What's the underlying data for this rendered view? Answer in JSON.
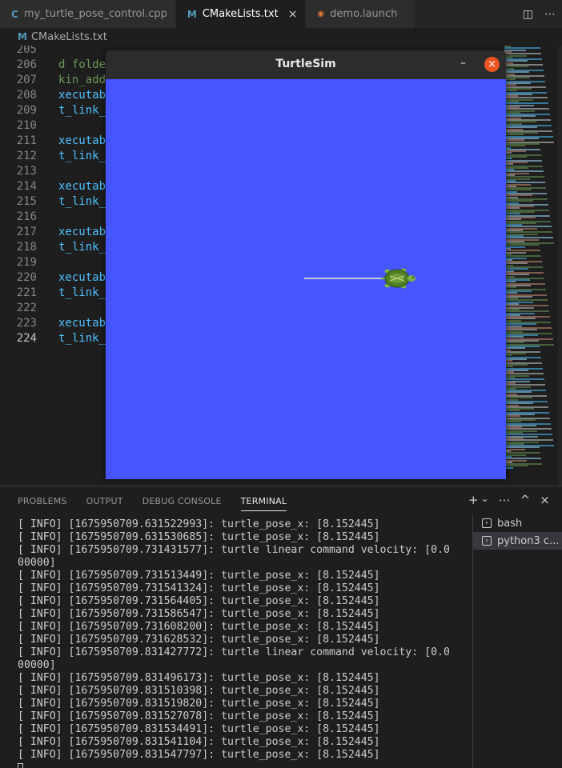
{
  "tabs": [
    {
      "icon": "C",
      "label": "my_turtle_pose_control.cpp",
      "color": "#519aba"
    },
    {
      "icon": "M",
      "label": "CMakeLists.txt",
      "color": "#519aba",
      "close": "×"
    },
    {
      "icon": "RSS",
      "label": "demo.launch",
      "color": "#e37933"
    }
  ],
  "breadcrumb": {
    "icon": "M",
    "label": "CMakeLists.txt"
  },
  "editor": {
    "lines": [
      {
        "num": "205",
        "text": "",
        "cls": ""
      },
      {
        "num": "206",
        "text": "d folde",
        "cls": "c-green"
      },
      {
        "num": "207",
        "text": "kin_add",
        "cls": "c-green"
      },
      {
        "num": "208",
        "text": "xecutab",
        "cls": "c-blue"
      },
      {
        "num": "209",
        "text": "t_link_",
        "cls": "c-blue"
      },
      {
        "num": "210",
        "text": "",
        "cls": ""
      },
      {
        "num": "211",
        "text": "xecutab",
        "cls": "c-blue"
      },
      {
        "num": "212",
        "text": "t_link_",
        "cls": "c-blue"
      },
      {
        "num": "213",
        "text": "",
        "cls": ""
      },
      {
        "num": "214",
        "text": "xecutab",
        "cls": "c-blue"
      },
      {
        "num": "215",
        "text": "t_link_",
        "cls": "c-blue"
      },
      {
        "num": "216",
        "text": "",
        "cls": ""
      },
      {
        "num": "217",
        "text": "xecutab",
        "cls": "c-blue"
      },
      {
        "num": "218",
        "text": "t_link_",
        "cls": "c-blue"
      },
      {
        "num": "219",
        "text": "",
        "cls": ""
      },
      {
        "num": "220",
        "text": "xecutab",
        "cls": "c-blue"
      },
      {
        "num": "221",
        "text": "t_link_",
        "cls": "c-blue"
      },
      {
        "num": "222",
        "text": "",
        "cls": ""
      },
      {
        "num": "223",
        "text": "xecutab",
        "cls": "c-blue"
      },
      {
        "num": "224",
        "text": "t_link_",
        "cls": "c-blue"
      }
    ]
  },
  "turtlesim": {
    "title": "TurtleSim",
    "background": "#4556ff",
    "minimize": "–",
    "close": "×"
  },
  "panel": {
    "tabs": [
      "PROBLEMS",
      "OUTPUT",
      "DEBUG CONSOLE",
      "TERMINAL"
    ],
    "active_tab": "TERMINAL",
    "actions": [
      "+",
      "⌄",
      "⋯",
      "^",
      "×"
    ],
    "terminal_lines": [
      "[ INFO] [1675950709.631522993]: turtle_pose_x: [8.152445]",
      "[ INFO] [1675950709.631530685]: turtle_pose_x: [8.152445]",
      "[ INFO] [1675950709.731431577]: turtle linear command velocity: [0.0",
      "00000]",
      "[ INFO] [1675950709.731513449]: turtle_pose_x: [8.152445]",
      "[ INFO] [1675950709.731541324]: turtle_pose_x: [8.152445]",
      "[ INFO] [1675950709.731564405]: turtle_pose_x: [8.152445]",
      "[ INFO] [1675950709.731586547]: turtle_pose_x: [8.152445]",
      "[ INFO] [1675950709.731608200]: turtle_pose_x: [8.152445]",
      "[ INFO] [1675950709.731628532]: turtle_pose_x: [8.152445]",
      "[ INFO] [1675950709.831427772]: turtle linear command velocity: [0.0",
      "00000]",
      "[ INFO] [1675950709.831496173]: turtle_pose_x: [8.152445]",
      "[ INFO] [1675950709.831510398]: turtle_pose_x: [8.152445]",
      "[ INFO] [1675950709.831519820]: turtle_pose_x: [8.152445]",
      "[ INFO] [1675950709.831527078]: turtle_pose_x: [8.152445]",
      "[ INFO] [1675950709.831534491]: turtle_pose_x: [8.152445]",
      "[ INFO] [1675950709.831541104]: turtle_pose_x: [8.152445]",
      "[ INFO] [1675950709.831547797]: turtle_pose_x: [8.152445]"
    ],
    "terminals": [
      {
        "label": "bash"
      },
      {
        "label": "python3 c..."
      }
    ]
  }
}
